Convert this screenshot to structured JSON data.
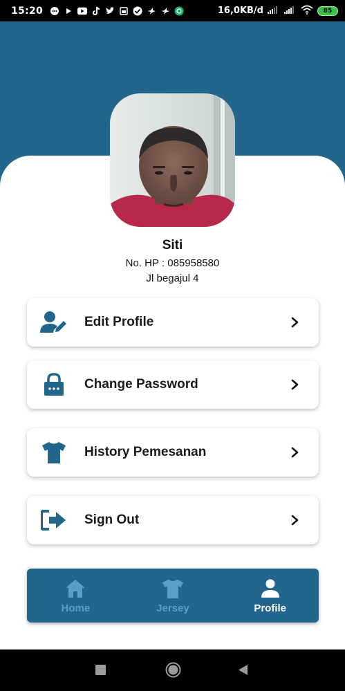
{
  "status_bar": {
    "time": "15:20",
    "network_speed": "16,0KB/d",
    "battery": "85",
    "notification_icons": [
      "chat-icon",
      "play-icon",
      "youtube-icon",
      "tiktok-icon",
      "twitter-icon",
      "gallery-icon",
      "check-icon",
      "bird-icon",
      "bird-icon",
      "vpn-icon"
    ]
  },
  "profile": {
    "name": "Siti",
    "phone": "No. HP : 085958580",
    "address": "Jl begajul 4"
  },
  "menu": {
    "items": [
      {
        "label": "Edit Profile",
        "icon": "edit-user-icon"
      },
      {
        "label": "Change Password",
        "icon": "lock-icon"
      },
      {
        "label": "History Pemesanan",
        "icon": "shirt-icon"
      },
      {
        "label": "Sign Out",
        "icon": "sign-out-icon"
      }
    ]
  },
  "bottom_nav": {
    "items": [
      {
        "label": "Home",
        "icon": "home-icon",
        "active": false
      },
      {
        "label": "Jersey",
        "icon": "shirt-icon",
        "active": false
      },
      {
        "label": "Profile",
        "icon": "user-icon",
        "active": true
      }
    ]
  },
  "colors": {
    "primary": "#22668b",
    "inactive_nav": "#5b9ec7",
    "active_nav": "#ffffff"
  }
}
